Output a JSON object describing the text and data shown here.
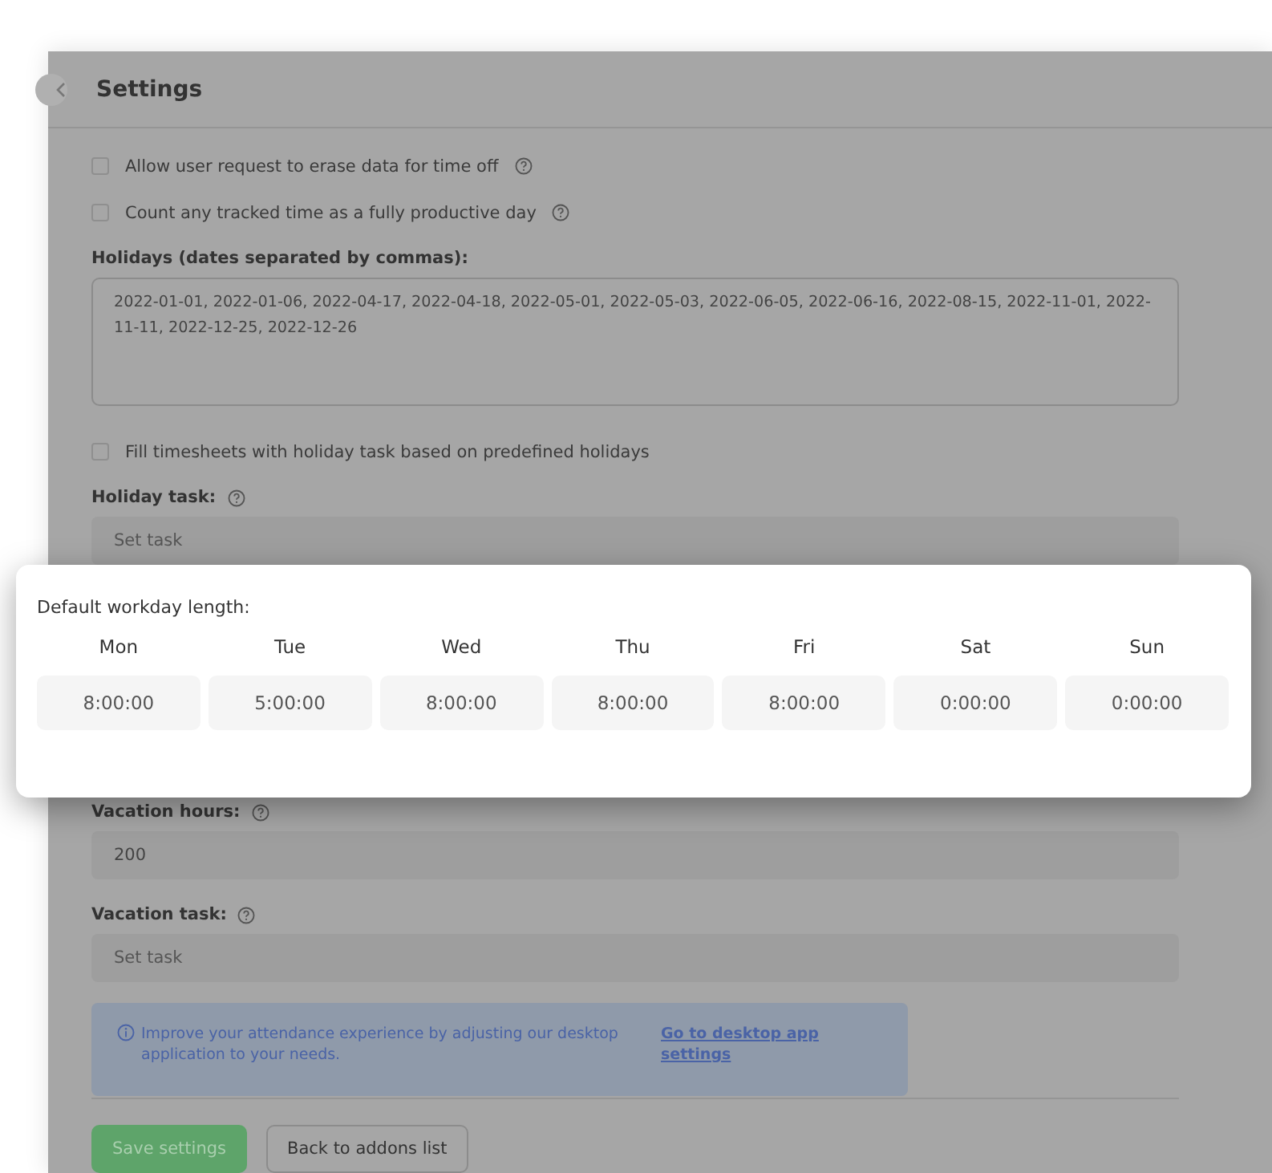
{
  "header": {
    "title": "Settings"
  },
  "options": [
    {
      "label": "Allow user request to erase data for time off",
      "checked": false,
      "help": true
    },
    {
      "label": "Count any tracked time as a fully productive day",
      "checked": false,
      "help": true
    }
  ],
  "holidays": {
    "label": "Holidays (dates separated by commas):",
    "value": "2022-01-01, 2022-01-06, 2022-04-17, 2022-04-18, 2022-05-01, 2022-05-03, 2022-06-05, 2022-06-16, 2022-08-15, 2022-11-01, 2022-11-11, 2022-12-25, 2022-12-26"
  },
  "fill_option": {
    "label": "Fill timesheets with holiday task based on predefined holidays",
    "checked": false
  },
  "holiday_task": {
    "label": "Holiday task:",
    "placeholder": "Set task"
  },
  "vacation_hours": {
    "label": "Vacation hours:",
    "value": "200"
  },
  "vacation_task": {
    "label": "Vacation task:",
    "placeholder": "Set task"
  },
  "info": {
    "text": "Improve your attendance experience by adjusting our desktop application to your needs.",
    "link": "Go to desktop app settings"
  },
  "buttons": [
    {
      "label": "Save settings",
      "kind": "primary"
    },
    {
      "label": "Back to addons list",
      "kind": "secondary"
    }
  ],
  "popup": {
    "title": "Default workday length:",
    "days": [
      {
        "day": "Mon",
        "value": "8:00:00"
      },
      {
        "day": "Tue",
        "value": "5:00:00"
      },
      {
        "day": "Wed",
        "value": "8:00:00"
      },
      {
        "day": "Thu",
        "value": "8:00:00"
      },
      {
        "day": "Fri",
        "value": "8:00:00"
      },
      {
        "day": "Sat",
        "value": "0:00:00"
      },
      {
        "day": "Sun",
        "value": "0:00:00"
      }
    ]
  }
}
